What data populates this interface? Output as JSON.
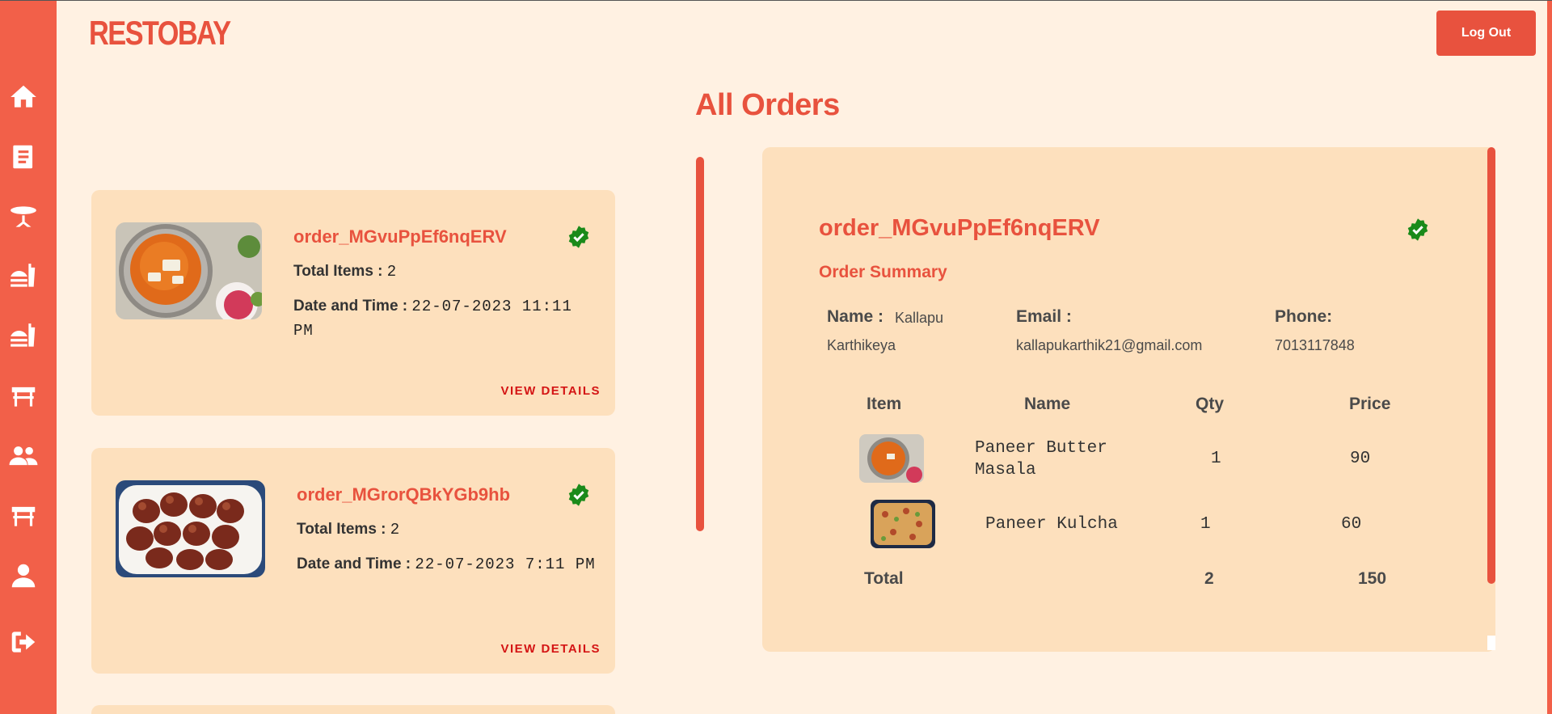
{
  "brand": "RESTOBAY",
  "logout_label": "Log Out",
  "page_title": "All Orders",
  "sidebar": {
    "items": [
      {
        "icon": "home-icon"
      },
      {
        "icon": "menu-book-icon"
      },
      {
        "icon": "table-icon"
      },
      {
        "icon": "food-order-icon"
      },
      {
        "icon": "food-order-2-icon"
      },
      {
        "icon": "bench-icon"
      },
      {
        "icon": "users-icon"
      },
      {
        "icon": "bench-2-icon"
      },
      {
        "icon": "user-icon"
      },
      {
        "icon": "sign-out-icon"
      }
    ]
  },
  "orders": [
    {
      "id": "order_MGvuPpEf6nqERV",
      "total_items_label": "Total Items :",
      "total_items": "2",
      "datetime_label": "Date and Time :",
      "datetime": "22-07-2023 11:11 PM",
      "view_label": "VIEW DETAILS",
      "image": "paneer-curry"
    },
    {
      "id": "order_MGrorQBkYGb9hb",
      "total_items_label": "Total Items :",
      "total_items": "2",
      "datetime_label": "Date and Time :",
      "datetime": "22-07-2023 7:11 PM",
      "view_label": "VIEW DETAILS",
      "image": "gulab-jamun"
    }
  ],
  "detail": {
    "id": "order_MGvuPpEf6nqERV",
    "summary_title": "Order Summary",
    "name_label": "Name :",
    "name_value": "Kallapu Karthikeya",
    "email_label": "Email :",
    "email_value": "kallapukarthik21@gmail.com",
    "phone_label": "Phone:",
    "phone_value": "7013117848",
    "columns": [
      "Item",
      "Name",
      "Qty",
      "Price"
    ],
    "rows": [
      {
        "name": "Paneer Butter Masala",
        "qty": "1",
        "price": "90",
        "image": "paneer-curry"
      },
      {
        "name": "Paneer Kulcha",
        "qty": "1",
        "price": "60",
        "image": "kulcha"
      }
    ],
    "total_label": "Total",
    "total_qty": "2",
    "total_price": "150"
  },
  "colors": {
    "accent": "#e8523e",
    "sidebar": "#f26049",
    "background": "#fff1e2",
    "card": "#fde0bd",
    "verified": "#1a8a1a",
    "link": "#d41414"
  }
}
